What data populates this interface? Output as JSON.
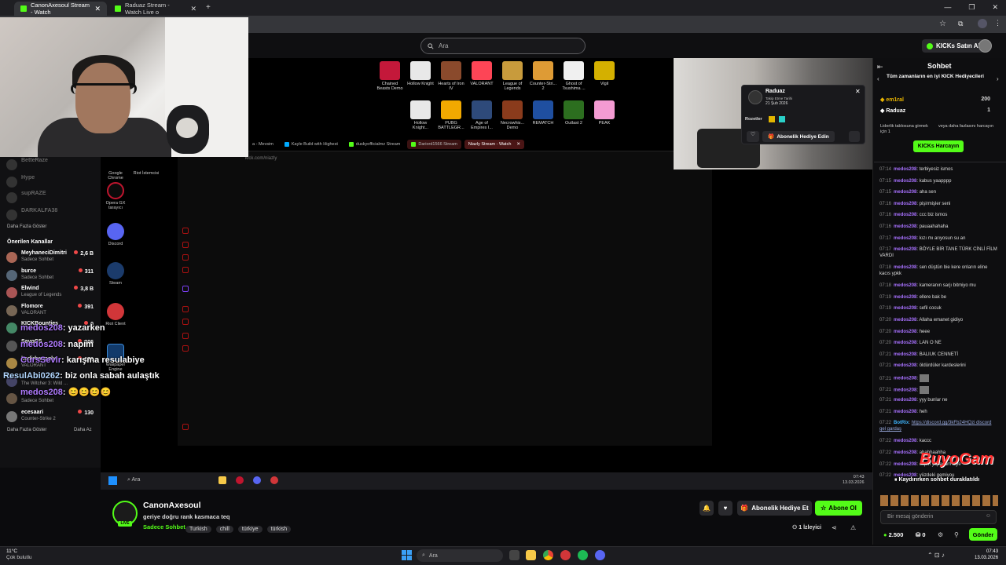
{
  "browser": {
    "tabs": [
      {
        "label": "CanonAxesoul Stream - Watch",
        "active": true
      },
      {
        "label": "Raduaz Stream - Watch Live o",
        "active": false
      }
    ]
  },
  "topbar": {
    "search_placeholder": "Ara",
    "buy_kicks": "KICKs Satın Al"
  },
  "sidebar": {
    "faded": [
      "BetteRaze",
      "Hype",
      "supRAZE",
      "DARKALFA38"
    ],
    "show_more_1": "Daha Fazla Göster",
    "recommended_title": "Önerilen Kanallar",
    "channels": [
      {
        "name": "MeyhaneciDimitri",
        "sub": "Sadece Sohbet",
        "count": "2,6 B"
      },
      {
        "name": "burce",
        "sub": "Sadece Sohbet",
        "count": "311"
      },
      {
        "name": "Elwind",
        "sub": "League of Legends",
        "count": "3,8 B"
      },
      {
        "name": "Flomore",
        "sub": "VALORANT",
        "count": "391"
      },
      {
        "name": "KICKBounties",
        "sub": "",
        "count": "0"
      },
      {
        "name": "SayoCS",
        "sub": "",
        "count": "206"
      },
      {
        "name": "bedirhanoglu",
        "sub": "VALORANT",
        "count": "170"
      },
      {
        "name": "",
        "sub": "The Witcher 3: Wild ...",
        "count": ""
      },
      {
        "name": "",
        "sub": "Sadece Sohbet",
        "count": ""
      },
      {
        "name": "ecesaari",
        "sub": "Counter-Strike 2",
        "count": "130"
      }
    ],
    "show_more_2": "Daha Fazla Göster",
    "show_less": "Daha Az"
  },
  "overlay_chat": [
    {
      "user": "medos208",
      "msg": ": yazarken"
    },
    {
      "user": "medos208",
      "msg": ": napim"
    },
    {
      "user": "CursSevlr",
      "msg": ": karışma resulabiye"
    },
    {
      "user": "ResulAbi0262",
      "msg": ": biz onla sabah aulaştık"
    },
    {
      "user": "medos208",
      "msg": ": 😊😊😊😊"
    }
  ],
  "desktop_icons": [
    "Google Chrome",
    "Riot İstemcisi",
    "Opera GX tarayıcı",
    "Discord",
    "Steam",
    "Riot Client",
    "Wallpaper Engine"
  ],
  "inner_tabs": [
    "a - Mevsim",
    "Kayle Build with Highest",
    "duskyofficialmz Stream",
    "Dariord1566 Stream",
    "Niazly Stream - Watch"
  ],
  "inner_url": "kick.com/niazly",
  "games": [
    {
      "name": "Chained Beasts Demo",
      "color": "#c4183a"
    },
    {
      "name": "Hollow Knight",
      "color": "#e8e8e8"
    },
    {
      "name": "Hearts of Iron IV",
      "color": "#8a4a2c"
    },
    {
      "name": "VALORANT",
      "color": "#fd4556"
    },
    {
      "name": "League of Legends",
      "color": "#c89b3c"
    },
    {
      "name": "Counter-Stri... 2",
      "color": "#de9b35"
    },
    {
      "name": "Ghost of Tsushima ...",
      "color": "#f0f0f0"
    },
    {
      "name": "Vigil",
      "color": "#d4b000"
    },
    {
      "name": "Hollow Knight...",
      "color": "#e8e8e8"
    },
    {
      "name": "PUBG BATTLEGR...",
      "color": "#f2a900"
    },
    {
      "name": "Age of Empires I...",
      "color": "#2e4a7a"
    },
    {
      "name": "Necrowhis... Demo",
      "color": "#8a3b1c"
    },
    {
      "name": "REMATCH",
      "color": "#1f4fa0"
    },
    {
      "name": "Outlast 2",
      "color": "#2c6e1f"
    },
    {
      "name": "PEAK",
      "color": "#f49bd2"
    }
  ],
  "inner_taskbar": {
    "search": "Ara",
    "time": "07:43",
    "date": "13.03.2026"
  },
  "popup": {
    "name": "Raduaz",
    "follow_label": "Takip Etme Tarihi",
    "follow_date": "21 Şub 2026",
    "badges_label": "Rozetler",
    "gift_sub": "Abonelik Hediye Edin"
  },
  "chat": {
    "title": "Sohbet",
    "leader_title": "Tüm zamanların en iyi KICK Hediyecileri",
    "leaders": [
      {
        "name": "em1ral",
        "value": "200"
      },
      {
        "name": "Raduaz",
        "value": "1"
      }
    ],
    "leader_note": "Liderlik tablosuna girmek için 1",
    "leader_note2": "veya daha fazlasını harcayın",
    "spend_button": "KICKs Harcayın",
    "messages": [
      {
        "t": "07:14",
        "u": "medos208",
        "m": "terbiyesiz ismos"
      },
      {
        "t": "07:15",
        "u": "medos208",
        "m": "kabus yaapppp"
      },
      {
        "t": "07:15",
        "u": "medos208",
        "m": "aha sen"
      },
      {
        "t": "07:16",
        "u": "medos208",
        "m": "pişirmişler seni"
      },
      {
        "t": "07:16",
        "u": "medos208",
        "m": "ccc biz ismos"
      },
      {
        "t": "07:16",
        "u": "medos208",
        "m": "pauaahahaha"
      },
      {
        "t": "07:17",
        "u": "medos208",
        "m": "kızı mı arıyosun su an"
      },
      {
        "t": "07:17",
        "u": "medos208",
        "m": "BÖYLE BİR TANE TÜRK CİNLİ FİLM VARDI"
      },
      {
        "t": "07:18",
        "u": "medos208",
        "m": "sen düştün bie kere onların eline kacıs ypkk"
      },
      {
        "t": "07:18",
        "u": "medos208",
        "m": "kameranın sarjı bitmiyo mu"
      },
      {
        "t": "07:19",
        "u": "medos208",
        "m": "ellere bak be"
      },
      {
        "t": "07:19",
        "u": "medos208",
        "m": "sefil cocuk"
      },
      {
        "t": "07:20",
        "u": "medos208",
        "m": "Allaha emanet gidiyo"
      },
      {
        "t": "07:20",
        "u": "medos208",
        "m": "heee"
      },
      {
        "t": "07:20",
        "u": "medos208",
        "m": "LAN O NE"
      },
      {
        "t": "07:21",
        "u": "medos208",
        "m": "BALIUK CENNETİ"
      },
      {
        "t": "07:21",
        "u": "medos208",
        "m": "öldürdüler kardeslerini"
      },
      {
        "t": "07:21",
        "u": "medos208",
        "m": ""
      },
      {
        "t": "07:21",
        "u": "medos208",
        "m": ""
      },
      {
        "t": "07:21",
        "u": "medos208",
        "m": "yyy bunlar ne"
      },
      {
        "t": "07:21",
        "u": "medos208",
        "m": "heh"
      },
      {
        "t": "07:22",
        "u": "BotRix",
        "m": "https://discord.gg/3kFb24HQzi discord gel gardaş"
      },
      {
        "t": "07:22",
        "u": "medos208",
        "m": "kaccc"
      },
      {
        "t": "07:22",
        "u": "medos208",
        "m": "ahahhaahha"
      },
      {
        "t": "07:22",
        "u": "medos208",
        "m": "espiri yapacam diye"
      },
      {
        "t": "07:22",
        "u": "medos208",
        "m": "yüzdeki gemiyou"
      }
    ],
    "paused": "Kaydırırken sohbet duraklatıldı",
    "watermark": "BuyoGam",
    "input_placeholder": "Bir mesaj gönderin",
    "kicks_balance": "2.500",
    "gift_count": "0",
    "send": "Gönder"
  },
  "stream": {
    "streamer": "CanonAxesoul",
    "title": "geriye doğru rank kasmaca teq",
    "category": "Sadece Sohbet",
    "tags": [
      "Turkish",
      "chill",
      "türkiye",
      "türkish"
    ],
    "live_label": "LIVE",
    "viewers": "1 İzleyici",
    "gift_sub": "Abonelik Hediye Et",
    "follow": "Abone Ol"
  },
  "os": {
    "weather_temp": "11°C",
    "weather_text": "Çok bulutlu",
    "search": "Ara",
    "time": "07:43",
    "date": "13.03.2026"
  }
}
